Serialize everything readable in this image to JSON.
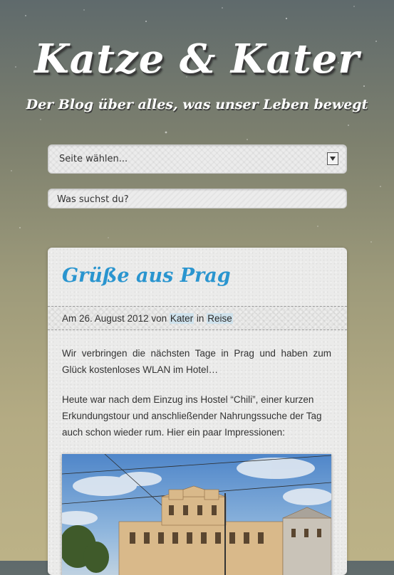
{
  "site": {
    "title": "Katze & Kater",
    "tagline": "Der Blog über alles, was unser Leben bewegt"
  },
  "nav": {
    "select_label": "Seite wählen..."
  },
  "search": {
    "placeholder": "Was suchst du?"
  },
  "post": {
    "title": "Grüße aus Prag",
    "meta_prefix": "Am 26. August 2012 von",
    "author": "Kater",
    "meta_in": "in",
    "category": "Reise",
    "paragraph_1": "Wir verbringen die nächsten Tage in Prag und haben zum Glück kostenloses WLAN im Hotel…",
    "paragraph_2": "Heute war nach dem Einzug ins Hostel “Chili”, einer kurzen Erkundungstour und anschließender Nahrungssuche der Tag auch schon wieder rum. Hier ein paar Impressionen:",
    "image_subject": "Prague building photo"
  },
  "colors": {
    "accent": "#2a95cf",
    "title_text": "#ffffff",
    "link_highlight": "#cfe2ec"
  }
}
